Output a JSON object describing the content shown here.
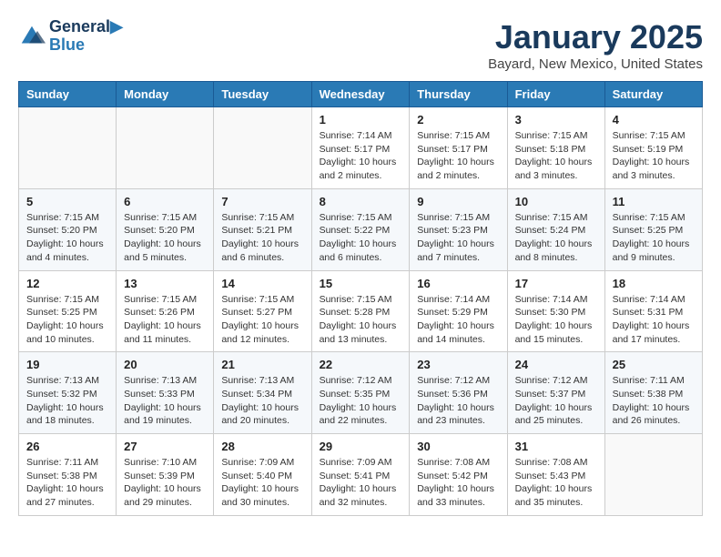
{
  "header": {
    "logo_line1": "General",
    "logo_line2": "Blue",
    "month": "January 2025",
    "location": "Bayard, New Mexico, United States"
  },
  "weekdays": [
    "Sunday",
    "Monday",
    "Tuesday",
    "Wednesday",
    "Thursday",
    "Friday",
    "Saturday"
  ],
  "weeks": [
    [
      {
        "day": "",
        "info": ""
      },
      {
        "day": "",
        "info": ""
      },
      {
        "day": "",
        "info": ""
      },
      {
        "day": "1",
        "info": "Sunrise: 7:14 AM\nSunset: 5:17 PM\nDaylight: 10 hours\nand 2 minutes."
      },
      {
        "day": "2",
        "info": "Sunrise: 7:15 AM\nSunset: 5:17 PM\nDaylight: 10 hours\nand 2 minutes."
      },
      {
        "day": "3",
        "info": "Sunrise: 7:15 AM\nSunset: 5:18 PM\nDaylight: 10 hours\nand 3 minutes."
      },
      {
        "day": "4",
        "info": "Sunrise: 7:15 AM\nSunset: 5:19 PM\nDaylight: 10 hours\nand 3 minutes."
      }
    ],
    [
      {
        "day": "5",
        "info": "Sunrise: 7:15 AM\nSunset: 5:20 PM\nDaylight: 10 hours\nand 4 minutes."
      },
      {
        "day": "6",
        "info": "Sunrise: 7:15 AM\nSunset: 5:20 PM\nDaylight: 10 hours\nand 5 minutes."
      },
      {
        "day": "7",
        "info": "Sunrise: 7:15 AM\nSunset: 5:21 PM\nDaylight: 10 hours\nand 6 minutes."
      },
      {
        "day": "8",
        "info": "Sunrise: 7:15 AM\nSunset: 5:22 PM\nDaylight: 10 hours\nand 6 minutes."
      },
      {
        "day": "9",
        "info": "Sunrise: 7:15 AM\nSunset: 5:23 PM\nDaylight: 10 hours\nand 7 minutes."
      },
      {
        "day": "10",
        "info": "Sunrise: 7:15 AM\nSunset: 5:24 PM\nDaylight: 10 hours\nand 8 minutes."
      },
      {
        "day": "11",
        "info": "Sunrise: 7:15 AM\nSunset: 5:25 PM\nDaylight: 10 hours\nand 9 minutes."
      }
    ],
    [
      {
        "day": "12",
        "info": "Sunrise: 7:15 AM\nSunset: 5:25 PM\nDaylight: 10 hours\nand 10 minutes."
      },
      {
        "day": "13",
        "info": "Sunrise: 7:15 AM\nSunset: 5:26 PM\nDaylight: 10 hours\nand 11 minutes."
      },
      {
        "day": "14",
        "info": "Sunrise: 7:15 AM\nSunset: 5:27 PM\nDaylight: 10 hours\nand 12 minutes."
      },
      {
        "day": "15",
        "info": "Sunrise: 7:15 AM\nSunset: 5:28 PM\nDaylight: 10 hours\nand 13 minutes."
      },
      {
        "day": "16",
        "info": "Sunrise: 7:14 AM\nSunset: 5:29 PM\nDaylight: 10 hours\nand 14 minutes."
      },
      {
        "day": "17",
        "info": "Sunrise: 7:14 AM\nSunset: 5:30 PM\nDaylight: 10 hours\nand 15 minutes."
      },
      {
        "day": "18",
        "info": "Sunrise: 7:14 AM\nSunset: 5:31 PM\nDaylight: 10 hours\nand 17 minutes."
      }
    ],
    [
      {
        "day": "19",
        "info": "Sunrise: 7:13 AM\nSunset: 5:32 PM\nDaylight: 10 hours\nand 18 minutes."
      },
      {
        "day": "20",
        "info": "Sunrise: 7:13 AM\nSunset: 5:33 PM\nDaylight: 10 hours\nand 19 minutes."
      },
      {
        "day": "21",
        "info": "Sunrise: 7:13 AM\nSunset: 5:34 PM\nDaylight: 10 hours\nand 20 minutes."
      },
      {
        "day": "22",
        "info": "Sunrise: 7:12 AM\nSunset: 5:35 PM\nDaylight: 10 hours\nand 22 minutes."
      },
      {
        "day": "23",
        "info": "Sunrise: 7:12 AM\nSunset: 5:36 PM\nDaylight: 10 hours\nand 23 minutes."
      },
      {
        "day": "24",
        "info": "Sunrise: 7:12 AM\nSunset: 5:37 PM\nDaylight: 10 hours\nand 25 minutes."
      },
      {
        "day": "25",
        "info": "Sunrise: 7:11 AM\nSunset: 5:38 PM\nDaylight: 10 hours\nand 26 minutes."
      }
    ],
    [
      {
        "day": "26",
        "info": "Sunrise: 7:11 AM\nSunset: 5:38 PM\nDaylight: 10 hours\nand 27 minutes."
      },
      {
        "day": "27",
        "info": "Sunrise: 7:10 AM\nSunset: 5:39 PM\nDaylight: 10 hours\nand 29 minutes."
      },
      {
        "day": "28",
        "info": "Sunrise: 7:09 AM\nSunset: 5:40 PM\nDaylight: 10 hours\nand 30 minutes."
      },
      {
        "day": "29",
        "info": "Sunrise: 7:09 AM\nSunset: 5:41 PM\nDaylight: 10 hours\nand 32 minutes."
      },
      {
        "day": "30",
        "info": "Sunrise: 7:08 AM\nSunset: 5:42 PM\nDaylight: 10 hours\nand 33 minutes."
      },
      {
        "day": "31",
        "info": "Sunrise: 7:08 AM\nSunset: 5:43 PM\nDaylight: 10 hours\nand 35 minutes."
      },
      {
        "day": "",
        "info": ""
      }
    ]
  ]
}
